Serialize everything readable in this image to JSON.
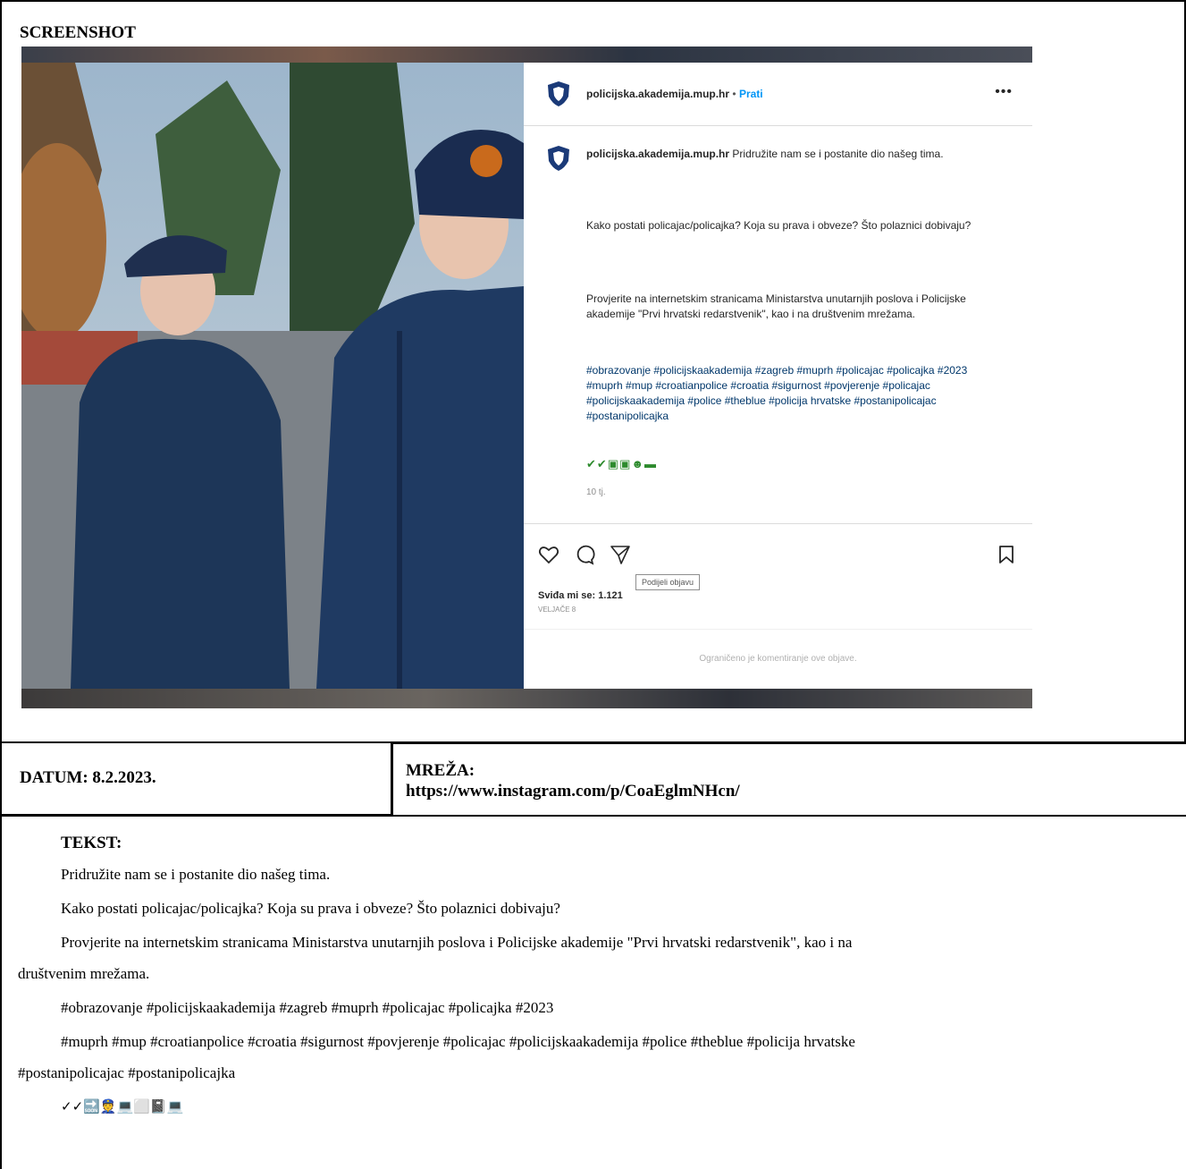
{
  "header": {
    "screenshot_label": "SCREENSHOT"
  },
  "post": {
    "account": "policijska.akademija.mup.hr",
    "separator": "•",
    "follow": "Prati",
    "more": "•••",
    "caption_lead": "Pridružite nam se i postanite dio našeg tima.",
    "caption_q": "Kako postati policajac/policajka? Koja su prava i obveze? Što polaznici dobivaju?",
    "caption_info": "Provjerite na internetskim stranicama Ministarstva unutarnjih poslova i Policijske akademije \"Prvi hrvatski redarstvenik\", kao i na društvenim mrežama.",
    "caption_tags": "#obrazovanje #policijskaakademija #zagreb #muprh #policajac #policajka #2023 #muprh #mup #croatianpolice #croatia #sigurnost #povjerenje #policajac #policijskaakademija #police #theblue #policija hrvatske #postanipolicajac #postanipolicajka",
    "emoji_row": "✔✔▣▣☻▬",
    "age": "10 tj.",
    "share_tooltip": "Podijeli objavu",
    "likes": "Sviđa mi se: 1.121",
    "date": "VELJAČE 8",
    "comments_limited": "Ograničeno je komentiranje ove objave."
  },
  "meta": {
    "date_label": "DATUM: 8.2.2023.",
    "network_label": "MREŽA:",
    "network_url": "https://www.instagram.com/p/CoaEglmNHcn/"
  },
  "text": {
    "label": "TEKST:",
    "p1": "Pridružite nam se i postanite dio našeg tima.",
    "p2": "Kako postati policajac/policajka? Koja su prava i obveze? Što polaznici dobivaju?",
    "p3a": "Provjerite na internetskim stranicama Ministarstva unutarnjih poslova i Policijske akademije \"Prvi hrvatski redarstvenik\", kao i na",
    "p3b": "društvenim mrežama.",
    "p4": "#obrazovanje #policijskaakademija #zagreb #muprh #policajac #policajka #2023",
    "p5a": "#muprh #mup #croatianpolice #croatia #sigurnost #povjerenje #policajac #policijskaakademija #police #theblue #policija hrvatske",
    "p5b": "#postanipolicajac #postanipolicajka",
    "p6": "✓✓🔜👮💻⬜📓💻"
  },
  "colors": {
    "link": "#0095f6",
    "hashtag": "#00376b",
    "border": "#000000"
  }
}
